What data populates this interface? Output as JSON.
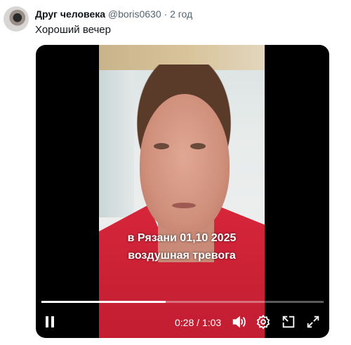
{
  "post": {
    "author_name": "Друг человека",
    "author_handle": "@boris0630",
    "separator": "·",
    "time": "2 год",
    "text": "Хороший вечер"
  },
  "video": {
    "caption_line1": "в Рязани 01,10 2025",
    "caption_line2": "воздушная тревога",
    "current_time": "0:28",
    "time_separator": "/",
    "duration": "1:03",
    "progress_fraction": 0.44,
    "controls": [
      "pause-icon",
      "volume-icon",
      "settings-icon",
      "pip-icon",
      "fullscreen-icon"
    ]
  }
}
